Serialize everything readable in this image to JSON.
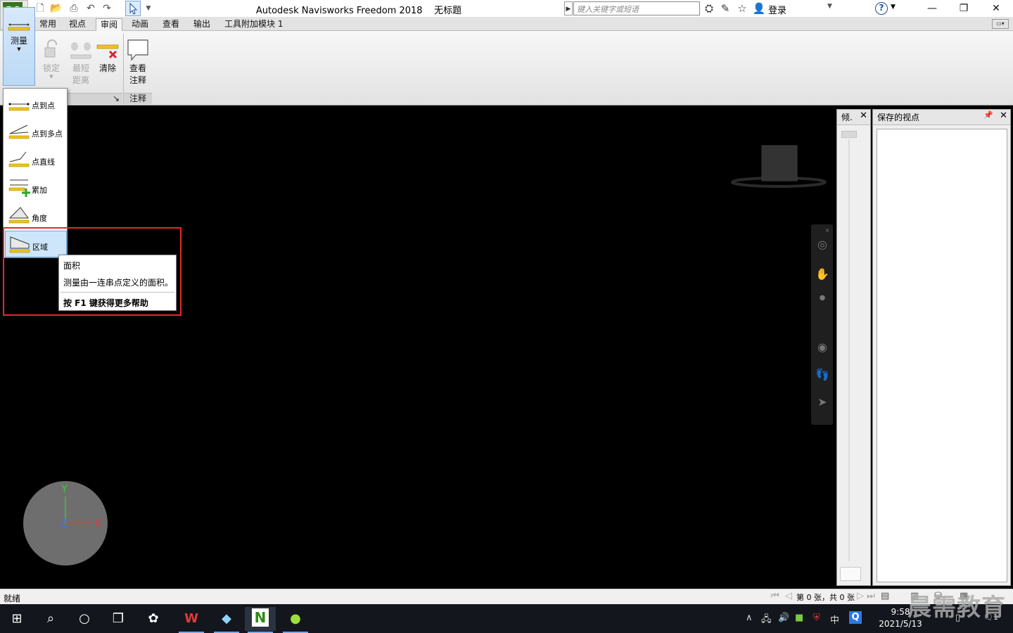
{
  "window": {
    "app_name": "Autodesk Navisworks Freedom 2018",
    "doc_title": "无标题",
    "search_placeholder": "键入关键字或短语",
    "login": "登录",
    "help": "?"
  },
  "tabs": [
    "常用",
    "视点",
    "审阅",
    "动画",
    "查看",
    "输出",
    "工具附加模块 1"
  ],
  "active_tab": "审阅",
  "ribbon": {
    "measure": "测量",
    "lock": "锁定",
    "shortest_1": "最短",
    "shortest_2": "距离",
    "clear": "清除",
    "view_1": "查看",
    "view_2": "注释",
    "panel_annotation": "注释"
  },
  "measure_menu": {
    "items": [
      "点到点",
      "点到多点",
      "点直线",
      "累加",
      "角度",
      "区域"
    ],
    "selected": "区域"
  },
  "tooltip": {
    "title": "面积",
    "description": "测量由一连串点定义的面积。",
    "help": "按 F1 键获得更多帮助"
  },
  "panes": {
    "tilt_title": "倾.",
    "viewpoints_title": "保存的视点"
  },
  "gizmo": {
    "y": "Y",
    "z": "Z",
    "x": "X"
  },
  "status": {
    "text": "就绪",
    "page_count": "第 0 张，共 0 张"
  },
  "taskbar": {
    "time": "9:58",
    "date": "2021/5/13",
    "ime": "中",
    "notifications": "1"
  },
  "watermark": "晨需教育",
  "colors": {
    "highlight": "#e5282e",
    "ribbon_active": "#bcd9f5",
    "viewport": "#000000"
  }
}
